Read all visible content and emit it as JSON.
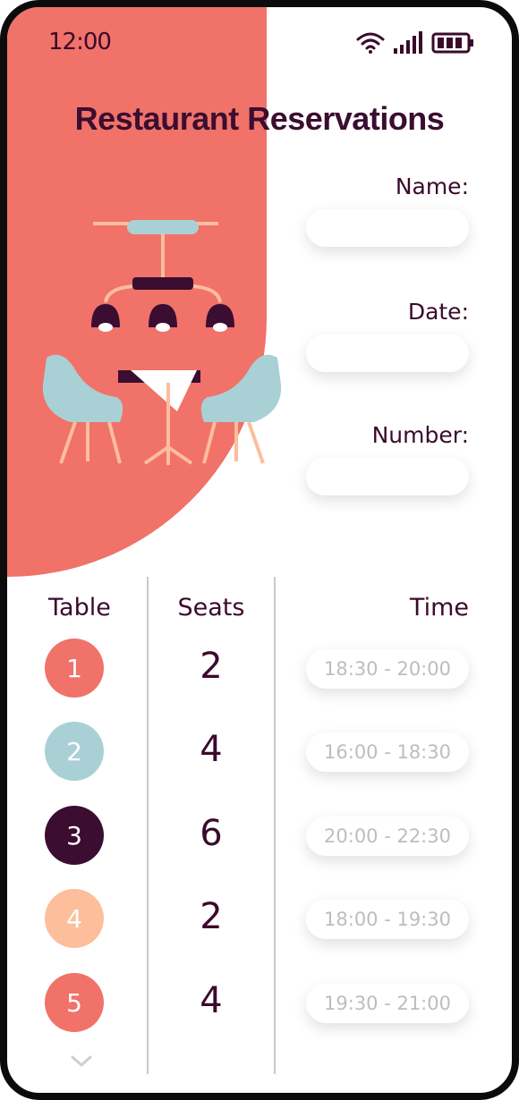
{
  "status_bar": {
    "time": "12:00",
    "wifi_icon": "wifi-icon",
    "signal_icon": "signal-icon",
    "battery_icon": "battery-icon"
  },
  "title": "Restaurant Reservations",
  "form": {
    "name_label": "Name:",
    "date_label": "Date:",
    "number_label": "Number:",
    "name_value": "",
    "date_value": "",
    "number_value": ""
  },
  "illustration": {
    "icon": "table-and-chairs-illustration"
  },
  "table": {
    "headers": {
      "table": "Table",
      "seats": "Seats",
      "time": "Time"
    },
    "rows": [
      {
        "table": "1",
        "seats": "2",
        "time": "18:30 - 20:00",
        "color": "#f07269"
      },
      {
        "table": "2",
        "seats": "4",
        "time": "16:00 - 18:30",
        "color": "#a9d1d5"
      },
      {
        "table": "3",
        "seats": "6",
        "time": "20:00 - 22:30",
        "color": "#3b0d31"
      },
      {
        "table": "4",
        "seats": "2",
        "time": "18:00 - 19:30",
        "color": "#fdbe9c"
      },
      {
        "table": "5",
        "seats": "4",
        "time": "19:30 - 21:00",
        "color": "#f07269"
      }
    ]
  },
  "colors": {
    "accent": "#f07269",
    "dark": "#3b0d31",
    "teal": "#a9d1d5",
    "peach": "#fdbe9c"
  },
  "scroll_icon": "chevron-down-icon"
}
